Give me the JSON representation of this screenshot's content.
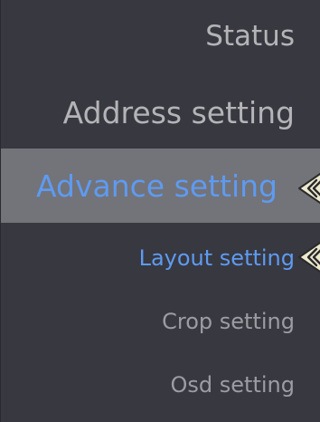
{
  "menu": {
    "items": [
      {
        "label": "Status"
      },
      {
        "label": "Address setting"
      },
      {
        "label": "Advance setting"
      },
      {
        "label": "Layout setting"
      },
      {
        "label": "Crop setting"
      },
      {
        "label": "Osd setting"
      }
    ],
    "selected_item": "Advance setting",
    "active_subitem": "Layout setting"
  },
  "icons": {
    "selection_pointer": "double-chevron-left-icon"
  },
  "colors": {
    "background": "#383841",
    "selected_background": "#73737a",
    "accent_text": "#5e9bf0",
    "primary_text": "#b4b4b8",
    "secondary_text": "#9c9ca2",
    "pointer_fill": "#ece9cf"
  }
}
